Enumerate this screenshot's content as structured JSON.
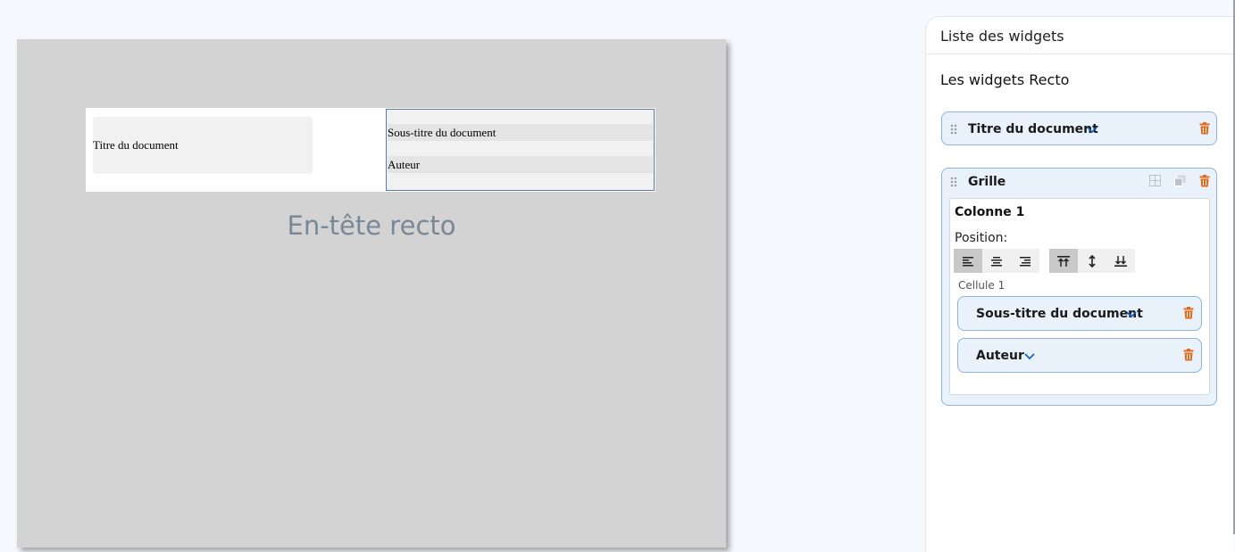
{
  "preview": {
    "title_cell": "Titre du document",
    "subtitle_cell": "Sous-titre du document",
    "author_cell": "Auteur",
    "caption": "En-tête recto"
  },
  "panel": {
    "title": "Liste des widgets",
    "section": "Les widgets Recto",
    "widgets": {
      "title": "Titre du document",
      "grid": {
        "label": "Grille",
        "column_title": "Colonne 1",
        "position_label": "Position:",
        "cell_label": "Cellule 1",
        "cell_widgets": [
          "Sous-titre du document",
          "Auteur"
        ]
      }
    }
  },
  "icons": {
    "drag": "drag-handle-icon",
    "chevron": "chevron-down-icon",
    "trash": "trash-icon",
    "align_left": "align-left-icon",
    "align_center": "align-center-icon",
    "align_right": "align-right-icon",
    "valign_top": "align-top-icon",
    "valign_middle": "align-middle-icon",
    "valign_bottom": "align-bottom-icon",
    "grid": "table-grid-icon",
    "duplicate": "duplicate-icon"
  },
  "colors": {
    "accent": "#1565c0",
    "delete": "#e46b1c",
    "widget_bg": "#e9f1fa",
    "widget_border": "#8fb3d9"
  },
  "state": {
    "horizontal_alignment": "left",
    "vertical_alignment": "top"
  }
}
